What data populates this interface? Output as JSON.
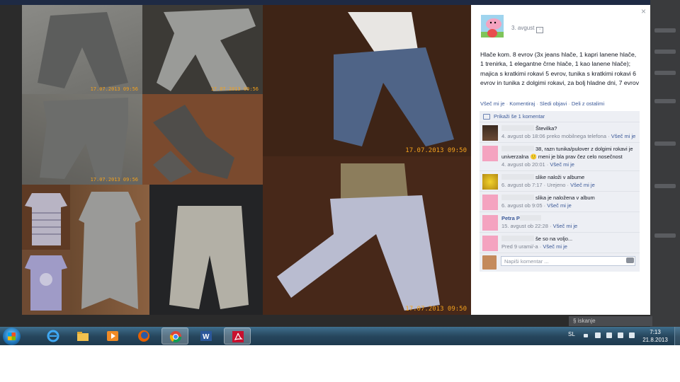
{
  "post": {
    "date": "3. avgust",
    "text": "Hlače kom. 8 evrov (3x jeans hlače, 1 kapri lanene hlače, 1 trenirka, 1 elegantne črne hlače, 1 kao lanene hlače); majica s kratkimi rokavi 5 evrov, tunika s kratkimi rokavi 6 evrov in tunika z dolgimi rokavi, za bolj hladne dni, 7 evrov"
  },
  "actions": {
    "like": "Všeč mi je",
    "comment": "Komentiraj",
    "follow": "Sledi objavi",
    "share": "Deli z ostalimi",
    "separator": "·"
  },
  "comments_box": {
    "show_more": "Prikaži še 1 komentar",
    "items": [
      {
        "name_visible": "",
        "text": "Številka?",
        "meta": "4. avgust ob 18:06 preko mobilnega telefona ·",
        "like": "Všeč mi je"
      },
      {
        "name_visible": "",
        "text": "38, razn tunika/pulover z dolgimi rokavi je univerzalna 🙂 meni je bla prav čez celo nosečnost",
        "meta": "4. avgust ob 20:01 ·",
        "like": "Všeč mi je"
      },
      {
        "name_visible": "",
        "text": "slike naloži v albume",
        "meta": "6. avgust ob 7:17 · Urejeno ·",
        "like": "Všeč mi je"
      },
      {
        "name_visible": "",
        "text": "slika je naložena v album",
        "meta": "6. avgust ob 9:05 ·",
        "like": "Všeč mi je"
      },
      {
        "name_visible": "Petra P",
        "text": "",
        "meta": "15. avgust ob 22:28 ·",
        "like": "Všeč mi je"
      },
      {
        "name_visible": "",
        "text": "še so na voljo...",
        "meta": "Pred 9 urami/-a ·",
        "like": "Všeč mi je"
      }
    ],
    "input_placeholder": "Napiši komentar ..."
  },
  "photo_stamps": {
    "small_1": "17.07.2013 09:56",
    "small_2": "17.07.2013 09:56",
    "small_3": "17.07.2013 09:56",
    "big_1": "17.07.2013 09:50",
    "big_2": "17.07.2013 09:50"
  },
  "viewer": {
    "close": "×"
  },
  "background": {
    "bottom_label": "§ iskanje"
  },
  "taskbar": {
    "apps": [
      "internet-explorer-icon",
      "file-explorer-icon",
      "media-player-icon",
      "firefox-icon",
      "chrome-icon",
      "word-icon",
      "acrobat-icon"
    ],
    "language": "SL",
    "time": "7:13",
    "date": "21.8.2013"
  },
  "colors": {
    "link": "#3b5998",
    "stamp": "#f3a11d",
    "comments_bg": "#edeff4"
  }
}
